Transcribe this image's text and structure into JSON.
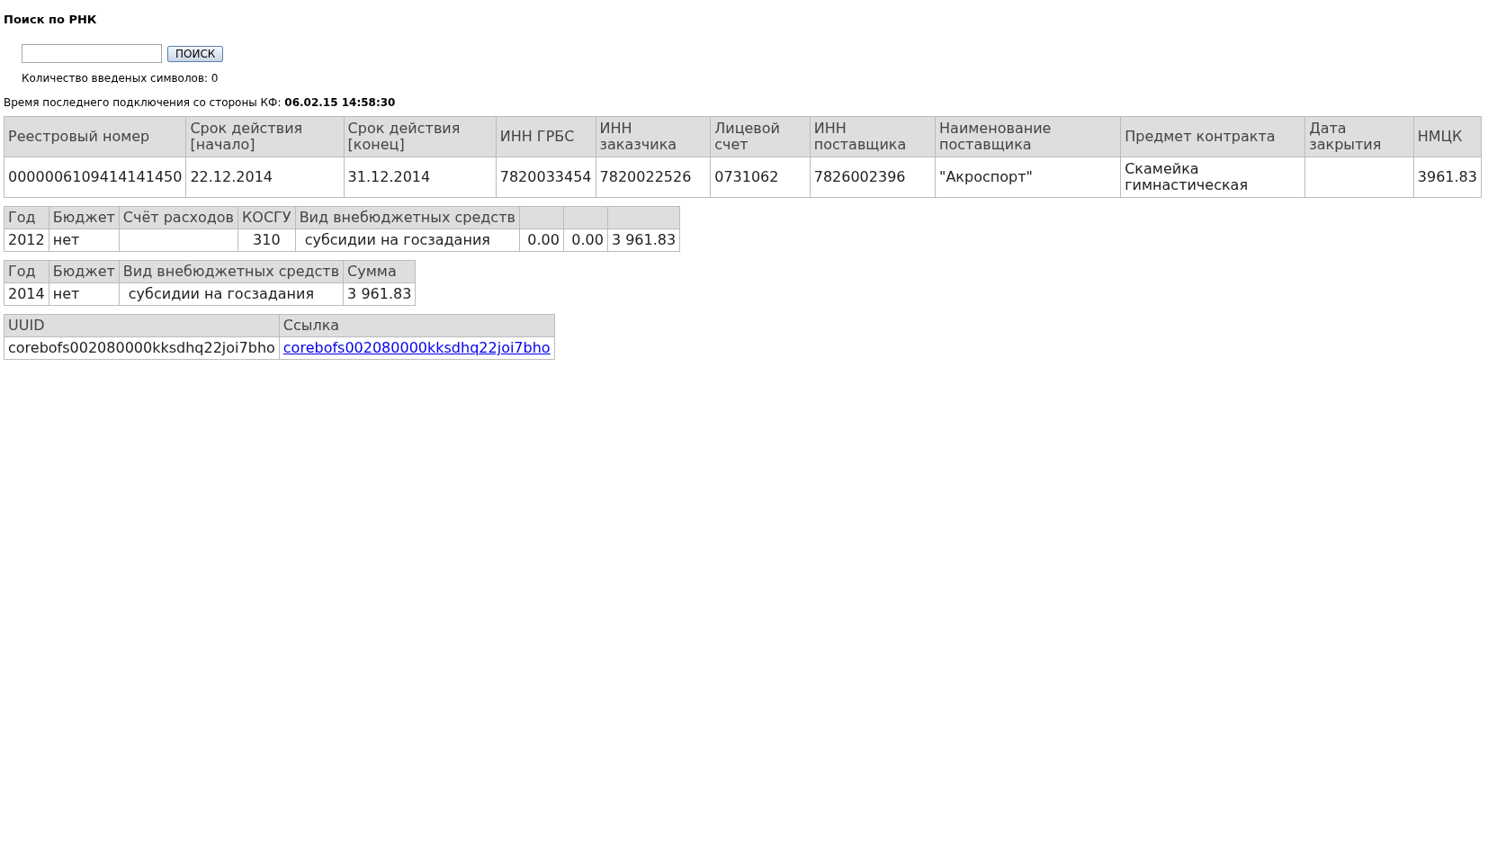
{
  "title": "Поиск по РНК",
  "search": {
    "button": "ПОИСК",
    "counter": "Количество введеных символов: 0"
  },
  "last_connection": {
    "label": "Время последнего подключения со стороны КФ:",
    "value": "06.02.15 14:58:30"
  },
  "tables": [
    {
      "columns": [
        {
          "label": "Реестровый номер"
        },
        {
          "label": "Срок действия [начало]"
        },
        {
          "label": "Срок действия [конец]"
        },
        {
          "label": "ИНН ГРБС"
        },
        {
          "label": "ИНН заказчика"
        },
        {
          "label": "Лицевой счет"
        },
        {
          "label": "ИНН поставщика"
        },
        {
          "label": "Наименование поставщика"
        },
        {
          "label": "Предмет контракта"
        },
        {
          "label": "Дата закрытия"
        },
        {
          "label": "НМЦК"
        }
      ],
      "rows": [
        [
          {
            "text": "0000006109414141450"
          },
          {
            "text": "22.12.2014"
          },
          {
            "text": "31.12.2014"
          },
          {
            "text": "7820033454"
          },
          {
            "text": "7820022526"
          },
          {
            "text": "0731062"
          },
          {
            "text": "7826002396"
          },
          {
            "text": "\"Акроспорт\""
          },
          {
            "text": "Скамейка гимнастическая"
          },
          {},
          {
            "text": "3961.83"
          }
        ]
      ]
    },
    {
      "columns": [
        {
          "label": "Год"
        },
        {
          "label": "Бюджет"
        },
        {
          "label": "Счёт расходов"
        },
        {
          "label": "КОСГУ"
        },
        {
          "label": "Вид внебюджетных средств"
        },
        {},
        {},
        {}
      ],
      "rows": [
        [
          {
            "text": "2012"
          },
          {
            "text": "нет"
          },
          {},
          {
            "text": "310"
          },
          {
            "text": "субсидии на госзадания"
          },
          {
            "text": "0.00"
          },
          {
            "text": "0.00"
          },
          {
            "text": "3 961.83"
          }
        ]
      ]
    },
    {
      "columns": [
        {
          "label": "Год"
        },
        {
          "label": "Бюджет"
        },
        {
          "label": "Вид внебюджетных средств"
        },
        {
          "label": "Сумма"
        }
      ],
      "rows": [
        [
          {
            "text": "2014"
          },
          {
            "text": "нет"
          },
          {
            "text": "субсидии на госзадания"
          },
          {
            "text": "3 961.83"
          }
        ]
      ]
    },
    {
      "columns": [
        {
          "label": "UUID"
        },
        {
          "label": "Ссылка"
        }
      ],
      "rows": [
        [
          {
            "text": "corebofs002080000kksdhq22joi7bho",
            "link": false
          },
          {
            "text": "corebofs002080000kksdhq22joi7bho",
            "link": true
          }
        ]
      ]
    }
  ]
}
